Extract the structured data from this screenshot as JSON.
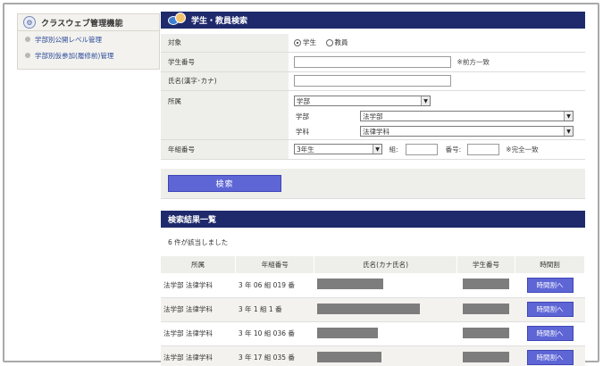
{
  "sidebar": {
    "title": "クラスウェブ管理機能",
    "items": [
      {
        "label": "学部別公開レベル管理"
      },
      {
        "label": "学部別仮参加(履修前)管理"
      }
    ]
  },
  "search_panel": {
    "title": "学生・教員検索",
    "target": {
      "label": "対象",
      "options": [
        {
          "label": "学生",
          "checked": true
        },
        {
          "label": "教員",
          "checked": false
        }
      ]
    },
    "student_number": {
      "label": "学生番号",
      "value": "",
      "hint": "※前方一致"
    },
    "name": {
      "label": "氏名(漢字･カナ)",
      "value": ""
    },
    "affiliation": {
      "label": "所属",
      "type_value": "学部",
      "faculty_label": "学部",
      "faculty_value": "法学部",
      "department_label": "学科",
      "department_value": "法律学科"
    },
    "grade_number": {
      "label": "年組番号",
      "grade_value": "3年生",
      "class_label": "組:",
      "class_value": "",
      "number_label": "番号:",
      "number_value": "",
      "hint": "※完全一致"
    },
    "search_button": "検索"
  },
  "results": {
    "title": "検索結果一覧",
    "message": "6 件が該当しました",
    "columns": [
      "所属",
      "年組番号",
      "氏名(カナ氏名)",
      "学生番号",
      "時間割"
    ],
    "button_label": "時間割へ",
    "rows": [
      {
        "affiliation": "法学部 法律学科",
        "grade": "3 年 06 組 019 番"
      },
      {
        "affiliation": "法学部 法律学科",
        "grade": "3 年 1 組 1 番"
      },
      {
        "affiliation": "法学部 法律学科",
        "grade": "3 年 10 組 036 番"
      },
      {
        "affiliation": "法学部 法律学科",
        "grade": "3 年 17 組 035 番"
      }
    ]
  },
  "colors": {
    "header_bg": "#1e2a6b",
    "button_bg": "#5e66d6",
    "label_bg": "#eeeeea",
    "link": "#2b4b9a"
  }
}
